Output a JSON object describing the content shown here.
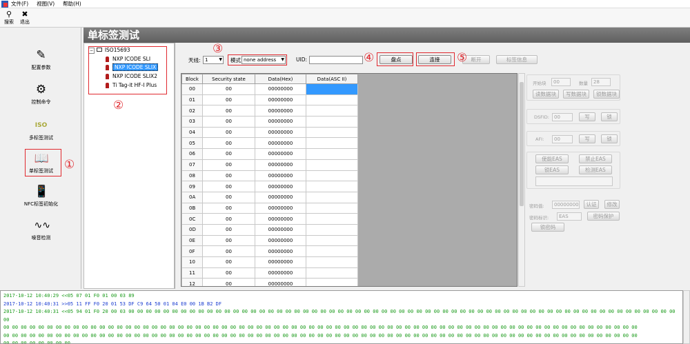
{
  "menu": {
    "items": [
      "文件(F)",
      "视图(V)",
      "帮助(H)"
    ]
  },
  "toolbar": {
    "search_label": "搜索",
    "exit_label": "退出"
  },
  "sidebar": {
    "items": [
      {
        "label": "配置参数",
        "icon": "config-edit-icon"
      },
      {
        "label": "控制命令",
        "icon": "gear-icon"
      },
      {
        "label": "多标签测试",
        "icon_text": "ISO"
      },
      {
        "label": "单标签测试",
        "icon": "book-icon"
      },
      {
        "label": "NFC标签初始化",
        "icon": "nfc-phone-icon"
      },
      {
        "label": "噪音检测",
        "icon": "waveform-icon"
      }
    ]
  },
  "title": "单标签测试",
  "tree": {
    "root": "ISO15693",
    "items": [
      "NXP ICODE SLI",
      "NXP ICODE SLIX",
      "NXP ICODE SLIX2",
      "Ti Tag-it HF-I Plus"
    ],
    "selected": "NXP ICODE SLIX"
  },
  "annotations": [
    "①",
    "②",
    "③",
    "④",
    "⑤"
  ],
  "controls": {
    "antenna_label": "天线:",
    "antenna_value": "1",
    "mode_label": "模式",
    "mode_value": "none address",
    "uid_label": "UID:",
    "inventory_button": "盘点",
    "connect_button": "连接",
    "disconnect_button": "断开",
    "tag_info_button": "标签信息"
  },
  "grid": {
    "columns": [
      "Block",
      "Security state",
      "Data(Hex)",
      "Data(ASC II)"
    ],
    "rows": [
      [
        "00",
        "00",
        "00000000",
        ""
      ],
      [
        "01",
        "00",
        "00000000",
        ""
      ],
      [
        "02",
        "00",
        "00000000",
        ""
      ],
      [
        "03",
        "00",
        "00000000",
        ""
      ],
      [
        "04",
        "00",
        "00000000",
        ""
      ],
      [
        "05",
        "00",
        "00000000",
        ""
      ],
      [
        "06",
        "00",
        "00000000",
        ""
      ],
      [
        "07",
        "00",
        "00000000",
        ""
      ],
      [
        "08",
        "00",
        "00000000",
        ""
      ],
      [
        "09",
        "00",
        "00000000",
        ""
      ],
      [
        "0A",
        "00",
        "00000000",
        ""
      ],
      [
        "0B",
        "00",
        "00000000",
        ""
      ],
      [
        "0C",
        "00",
        "00000000",
        ""
      ],
      [
        "0D",
        "00",
        "00000000",
        ""
      ],
      [
        "0E",
        "00",
        "00000000",
        ""
      ],
      [
        "0F",
        "00",
        "00000000",
        ""
      ],
      [
        "10",
        "00",
        "00000000",
        ""
      ],
      [
        "11",
        "00",
        "00000000",
        ""
      ],
      [
        "12",
        "00",
        "00000000",
        ""
      ]
    ]
  },
  "right_panel": {
    "start_block_label": "开始块",
    "start_block_value": "00",
    "count_label": "数量",
    "count_value": "28",
    "read_block_button": "读数据块",
    "write_block_button": "写数据块",
    "lock_block_button": "锁数据块",
    "dsfid_label": "DSFID:",
    "dsfid_value": "00",
    "dsfid_write": "写",
    "dsfid_lock": "锁",
    "afi_label": "AFI:",
    "afi_value": "00",
    "afi_write": "写",
    "afi_lock": "锁",
    "enable_eas": "使能EAS",
    "disable_eas": "禁止EAS",
    "lock_eas": "锁EAS",
    "detect_eas": "检测EAS",
    "password_value_label": "密码值:",
    "password_value": "00000000",
    "auth_button": "认证",
    "modify_button": "修改",
    "password_id_label": "密码标识:",
    "password_id_value": "EAS",
    "password_protect_button": "密码保护",
    "lock_password_button": "锁密码"
  },
  "log": [
    {
      "type": "rx",
      "text": "2017-10-12 10:40:29  <<05 07 01 F0 01 00 03 89"
    },
    {
      "type": "tx",
      "text": "2017-10-12 10:40:31  >>05 11 FF F0 20 01 53 DF C9 64 50 01 04 E0 00 1B B2 DF"
    },
    {
      "type": "rx",
      "text": "2017-10-12 10:40:31  <<05 94 01 F0 20 00 03 00 00 00 00 00 00 00 00 00 00 00 00 00 00 00 00 00 00 00 00 00 00 00 00 00 00 00 00 00 00 00 00 00 00 00 00 00 00 00 00 00 00 00 00 00 00 00 00 00 00 00 00 00 00 00 00 00 00 00 00 00 00 00 00"
    },
    {
      "type": "rx",
      "text": "00 00 00 00 00 00 00 00 00 00 00 00 00 00 00 00 00 00 00 00 00 00 00 00 00 00 00 00 00 00 00 00 00 00 00 00 00 00 00 00 00 00 00 00 00 00 00 00 00 00 00 00 00 00 00 00 00 00 00 00 00 00 00 00 00 00 00 00 00 00 00 00 00"
    },
    {
      "type": "rx",
      "text": "00 00 00 00 00 00 00 00 00 00 00 00 00 00 00 00 00 00 00 00 00 00 00 00 00 00 00 00 00 00 00 00 00 00 00 00 00 00 00 00 00 00 00 00 00 00 00 00 00 00 00 00 00 00 00 00 00 00 00 00 00 00 00 00 00 00 00 00 00 00 00 00 00"
    },
    {
      "type": "rx",
      "text": "00 00 00 00 00 00 00 00"
    }
  ]
}
